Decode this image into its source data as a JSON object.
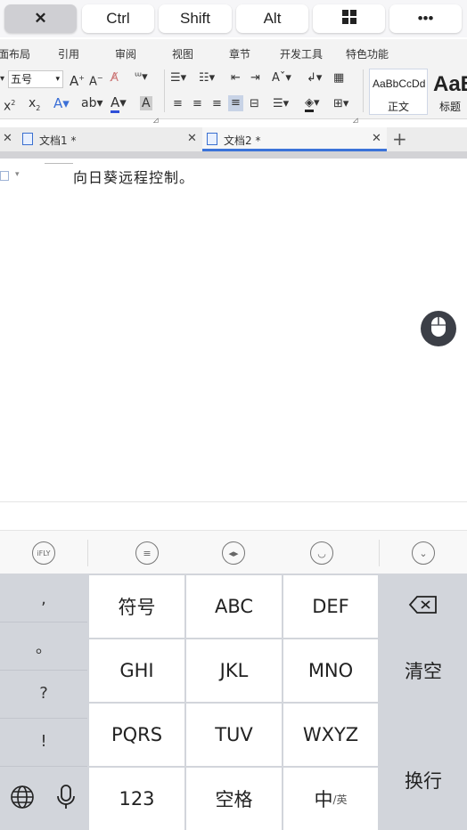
{
  "remote_keys": {
    "close": "✕",
    "ctrl": "Ctrl",
    "shift": "Shift",
    "alt": "Alt",
    "more": "•••"
  },
  "ribbon_tabs": [
    "面布局",
    "引用",
    "审阅",
    "视图",
    "章节",
    "开发工具",
    "特色功能"
  ],
  "ribbon": {
    "font_size": "五号",
    "style_normal_preview": "AaBbCcDd",
    "style_normal_label": "正文",
    "style_heading_preview": "AaB",
    "style_heading_label": "标题"
  },
  "doc_tabs": [
    {
      "label": "文档1 *"
    },
    {
      "label": "文档2 *"
    }
  ],
  "document": {
    "text": "向日葵远程控制。"
  },
  "ime_toolbar": {
    "logo": "iFLY"
  },
  "keyboard": {
    "punct": [
      ",",
      "。",
      "?",
      "!"
    ],
    "rows": [
      [
        "符号",
        "ABC",
        "DEF"
      ],
      [
        "GHI",
        "JKL",
        "MNO"
      ],
      [
        "PQRS",
        "TUV",
        "WXYZ"
      ]
    ],
    "num": "123",
    "space": "空格",
    "lang_main": "中",
    "lang_sub": "/英",
    "clear": "清空",
    "enter": "换行"
  },
  "colors": {
    "accent": "#2f6fdb",
    "keyboard_bg": "#d2d5db"
  }
}
